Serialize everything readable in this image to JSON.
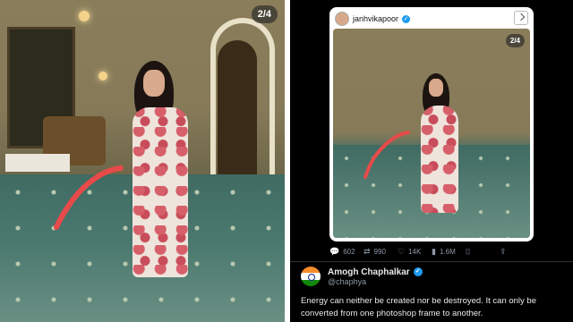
{
  "left_image": {
    "counter": "2/4"
  },
  "quoted": {
    "username": "janhvikapoor",
    "counter": "2/4"
  },
  "stats": [
    {
      "icon": "reply-icon",
      "value": "602"
    },
    {
      "icon": "retweet-icon",
      "value": "990"
    },
    {
      "icon": "heart-icon",
      "value": "14K"
    },
    {
      "icon": "views-icon",
      "value": "1.6M"
    },
    {
      "icon": "bookmark-icon",
      "value": ""
    },
    {
      "icon": "share-icon",
      "value": ""
    }
  ],
  "author": {
    "name": "Amogh Chaphalkar",
    "handle": "@chaphya",
    "flag_colors": [
      "#f58b2a",
      "#ffffff",
      "#138808"
    ]
  },
  "tweet": {
    "text": "Energy can neither be created nor be destroyed. It can only be converted from one photoshop frame to another."
  },
  "colors": {
    "accent": "#1d9bf0",
    "annotation_red": "#e84a4a"
  }
}
